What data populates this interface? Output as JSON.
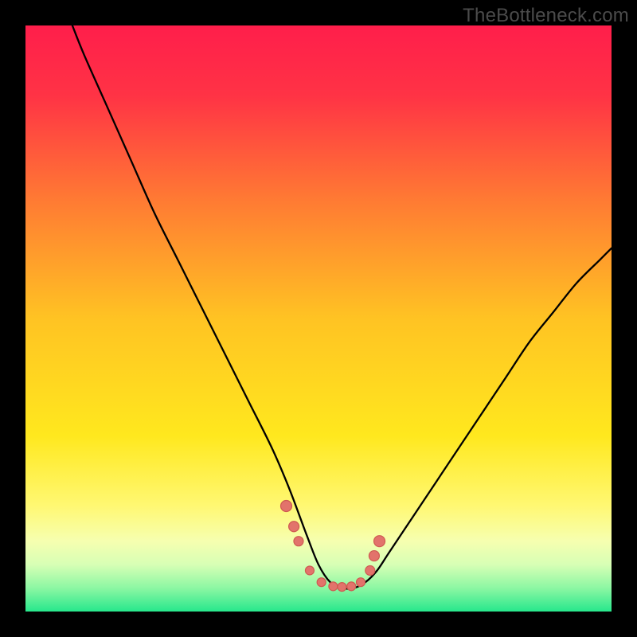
{
  "watermark": "TheBottleneck.com",
  "gradient": {
    "stops": [
      {
        "pct": 0,
        "color": "#ff1e4b"
      },
      {
        "pct": 12,
        "color": "#ff3345"
      },
      {
        "pct": 30,
        "color": "#ff7b33"
      },
      {
        "pct": 50,
        "color": "#ffc323"
      },
      {
        "pct": 70,
        "color": "#ffe81e"
      },
      {
        "pct": 82,
        "color": "#fff873"
      },
      {
        "pct": 88,
        "color": "#f6ffb0"
      },
      {
        "pct": 92,
        "color": "#d7ffb5"
      },
      {
        "pct": 96,
        "color": "#8cf7a3"
      },
      {
        "pct": 100,
        "color": "#27e78c"
      }
    ]
  },
  "curve_color": "#000000",
  "curve_width": 2.3,
  "dot_color": "#e2736b",
  "chart_data": {
    "type": "line",
    "title": "",
    "xlabel": "",
    "ylabel": "",
    "xlim": [
      0,
      100
    ],
    "ylim": [
      0,
      100
    ],
    "note": "x in 0–100 (plot width), y in 0–100 where 100=top, 0=bottom. Curve is a V-shaped bottleneck profile with minimum ≈50–56 on x, reaching y≈4. Right branch rises to ≈62 at x=100; left branch rises off-chart top near x≈8.",
    "series": [
      {
        "name": "bottleneck-curve",
        "x": [
          8,
          10,
          14,
          18,
          22,
          26,
          30,
          34,
          38,
          42,
          45,
          48,
          50,
          52,
          54,
          56,
          58,
          60,
          62,
          66,
          70,
          74,
          78,
          82,
          86,
          90,
          94,
          98,
          100
        ],
        "y": [
          100,
          95,
          86,
          77,
          68,
          60,
          52,
          44,
          36,
          28,
          21,
          13,
          8,
          5,
          4,
          4,
          5,
          7,
          10,
          16,
          22,
          28,
          34,
          40,
          46,
          51,
          56,
          60,
          62
        ]
      }
    ],
    "markers": {
      "name": "highlight-dots",
      "x": [
        44.5,
        45.8,
        46.6,
        48.5,
        50.5,
        52.5,
        54.0,
        55.6,
        57.2,
        58.8,
        59.5,
        60.4
      ],
      "y": [
        18.0,
        14.5,
        12.0,
        7.0,
        5.0,
        4.3,
        4.2,
        4.3,
        5.0,
        7.0,
        9.5,
        12.0
      ],
      "r": [
        7,
        6.5,
        6,
        5.5,
        5.5,
        5.5,
        5.5,
        5.5,
        5.5,
        6,
        6.5,
        7
      ]
    }
  }
}
